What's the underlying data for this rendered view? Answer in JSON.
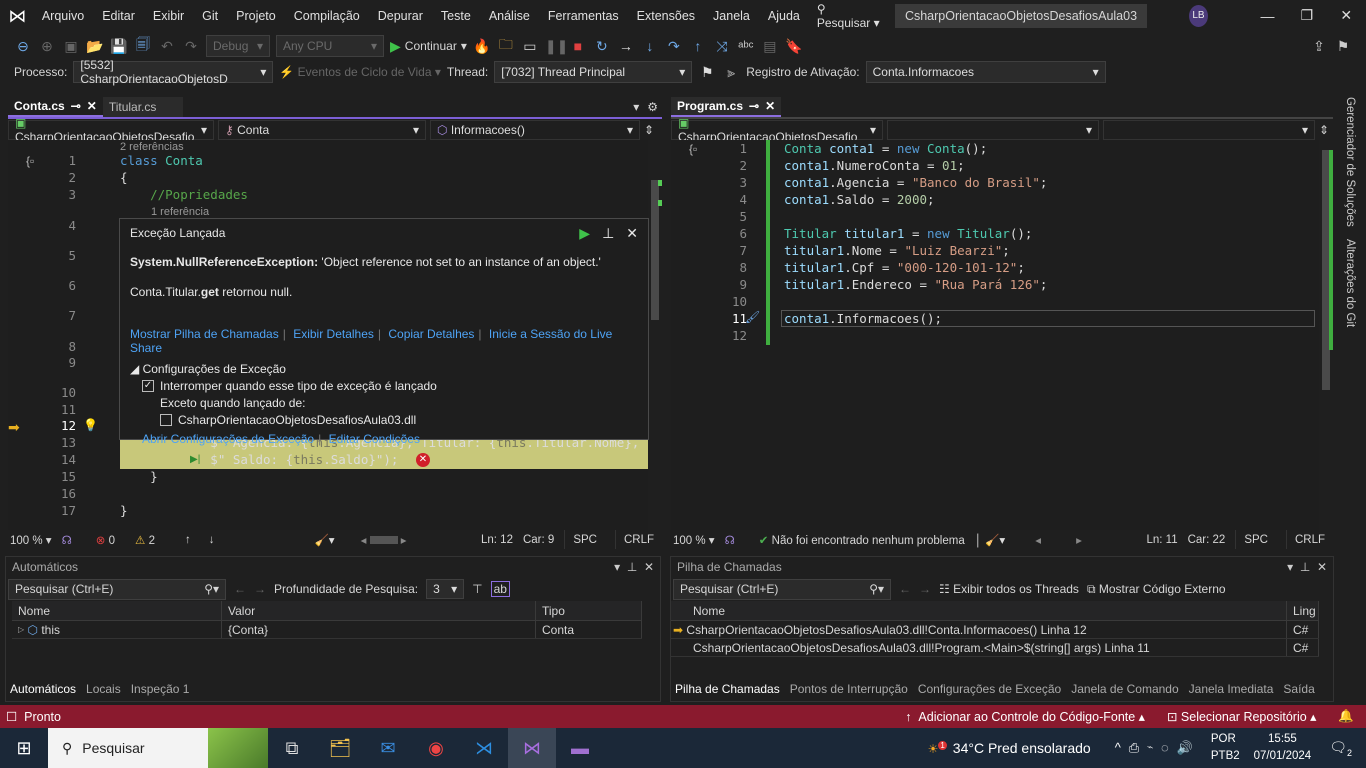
{
  "menubar": {
    "items": [
      "Arquivo",
      "Editar",
      "Exibir",
      "Git",
      "Projeto",
      "Compilação",
      "Depurar",
      "Teste",
      "Análise",
      "Ferramentas",
      "Extensões",
      "Janela",
      "Ajuda"
    ],
    "search": "Pesquisar",
    "title": "CsharpOrientacaoObjetosDesafiosAula03",
    "avatar": "LB"
  },
  "toolbar": {
    "config": "Debug",
    "platform": "Any CPU",
    "continue": "Continuar"
  },
  "debugbar": {
    "process_label": "Processo:",
    "process": "[5532] CsharpOrientacaoObjetosD",
    "lifecycle": "Eventos de Ciclo de Vida",
    "thread_label": "Thread:",
    "thread": "[7032] Thread Principal",
    "stack_label": "Registro de Ativação:",
    "stack": "Conta.Informacoes"
  },
  "left_editor": {
    "tabs": [
      {
        "label": "Conta.cs",
        "active": true
      },
      {
        "label": "Titular.cs",
        "active": false
      }
    ],
    "nav": [
      "CsharpOrientacaoObjetosDesafio",
      "Conta",
      "Informacoes()"
    ],
    "codelens": [
      "2 referências",
      "1 referência"
    ],
    "line_numbers": [
      "1",
      "2",
      "3",
      "4",
      "5",
      "6",
      "7",
      "8",
      "9",
      "10",
      "11",
      "12",
      "13",
      "14",
      "15",
      "16",
      "17"
    ],
    "current_line": "12",
    "code": [
      [
        [
          "kw",
          "class "
        ],
        [
          "ty",
          "Conta"
        ]
      ],
      [
        [
          "pl",
          "{"
        ]
      ],
      [
        [
          "cm",
          "    //Popriedades"
        ]
      ],
      [
        [
          "pl",
          "            $\" Agencia: {"
        ],
        [
          "dim",
          "this"
        ],
        [
          "pl",
          ".Agencia}, Titular: {"
        ],
        [
          "dim",
          "this"
        ],
        [
          "pl",
          ".Titular.Nome},"
        ]
      ],
      [
        [
          "pl",
          "            $\" Saldo: {"
        ],
        [
          "dim",
          "this"
        ],
        [
          "pl",
          ".Saldo}\");"
        ]
      ],
      [
        [
          "pl",
          "    }"
        ]
      ],
      [
        [
          "pl",
          "}"
        ]
      ]
    ],
    "status": {
      "zoom": "100 %",
      "errors": "0",
      "warnings": "2",
      "ln": "Ln: 12",
      "car": "Car: 9",
      "spc": "SPC",
      "crlf": "CRLF"
    }
  },
  "exception_popup": {
    "title": "Exceção Lançada",
    "exception_type": "System.NullReferenceException:",
    "message": "'Object reference not set to an instance of an object.'",
    "detail_pre": "Conta.Titular.",
    "detail_bold": "get",
    "detail_post": " retornou null.",
    "links": [
      "Mostrar Pilha de Chamadas",
      "Exibir Detalhes",
      "Copiar Detalhes",
      "Inicie a Sessão do Live Share"
    ],
    "settings_title": "Configurações de Exceção",
    "break_option": "Interromper quando esse tipo de exceção é lançado",
    "break_checked": true,
    "except_label": "Exceto quando lançado de:",
    "module": "CsharpOrientacaoObjetosDesafiosAula03.dll",
    "module_checked": false,
    "bottom_links": [
      "Abrir Configurações de Exceção",
      "Editar Condições"
    ]
  },
  "right_editor": {
    "tabs": [
      {
        "label": "Program.cs",
        "active": true
      }
    ],
    "nav": [
      "CsharpOrientacaoObjetosDesafio"
    ],
    "line_numbers": [
      "1",
      "2",
      "3",
      "4",
      "5",
      "6",
      "7",
      "8",
      "9",
      "10",
      "11",
      "12"
    ],
    "current_line": "11",
    "code": [
      [
        [
          "ty",
          "Conta "
        ],
        [
          "id",
          "conta1"
        ],
        [
          "pl",
          " = "
        ],
        [
          "kw",
          "new "
        ],
        [
          "ty",
          "Conta"
        ],
        [
          "pl",
          "();"
        ]
      ],
      [
        [
          "id",
          "conta1"
        ],
        [
          "pl",
          ".NumeroConta = "
        ],
        [
          "nu",
          "01"
        ],
        [
          "pl",
          ";"
        ]
      ],
      [
        [
          "id",
          "conta1"
        ],
        [
          "pl",
          ".Agencia = "
        ],
        [
          "st",
          "\"Banco do Brasil\""
        ],
        [
          "pl",
          ";"
        ]
      ],
      [
        [
          "id",
          "conta1"
        ],
        [
          "pl",
          ".Saldo = "
        ],
        [
          "nu",
          "2000"
        ],
        [
          "pl",
          ";"
        ]
      ],
      [],
      [
        [
          "ty",
          "Titular "
        ],
        [
          "id",
          "titular1"
        ],
        [
          "pl",
          " = "
        ],
        [
          "kw",
          "new "
        ],
        [
          "ty",
          "Titular"
        ],
        [
          "pl",
          "();"
        ]
      ],
      [
        [
          "id",
          "titular1"
        ],
        [
          "pl",
          ".Nome = "
        ],
        [
          "st",
          "\"Luiz Bearzi\""
        ],
        [
          "pl",
          ";"
        ]
      ],
      [
        [
          "id",
          "titular1"
        ],
        [
          "pl",
          ".Cpf = "
        ],
        [
          "st",
          "\"000-120-101-12\""
        ],
        [
          "pl",
          ";"
        ]
      ],
      [
        [
          "id",
          "titular1"
        ],
        [
          "pl",
          ".Endereco = "
        ],
        [
          "st",
          "\"Rua Pará 126\""
        ],
        [
          "pl",
          ";"
        ]
      ],
      [],
      [
        [
          "id",
          "conta1"
        ],
        [
          "pl",
          ".Informacoes();"
        ]
      ],
      []
    ],
    "status": {
      "zoom": "100 %",
      "health": "Não foi encontrado nenhum problema",
      "ln": "Ln: 11",
      "car": "Car: 22",
      "spc": "SPC",
      "crlf": "CRLF"
    }
  },
  "side_tabs": [
    "Gerenciador de Soluções",
    "Alterações do Git"
  ],
  "autos": {
    "title": "Automáticos",
    "search": "Pesquisar (Ctrl+E)",
    "depth_label": "Profundidade de Pesquisa:",
    "depth": "3",
    "columns": [
      "Nome",
      "Valor",
      "Tipo"
    ],
    "rows": [
      {
        "name": "this",
        "value": "{Conta}",
        "type": "Conta"
      }
    ],
    "tabs": [
      "Automáticos",
      "Locais",
      "Inspeção 1"
    ]
  },
  "callstack": {
    "title": "Pilha de Chamadas",
    "search": "Pesquisar (Ctrl+E)",
    "show_threads": "Exibir todos os Threads",
    "external": "Mostrar Código Externo",
    "columns": [
      "Nome",
      "Ling"
    ],
    "rows": [
      {
        "name": "CsharpOrientacaoObjetosDesafiosAula03.dll!Conta.Informacoes() Linha 12",
        "lang": "C#"
      },
      {
        "name": "CsharpOrientacaoObjetosDesafiosAula03.dll!Program.<Main>$(string[] args) Linha 11",
        "lang": "C#"
      }
    ],
    "tabs": [
      "Pilha de Chamadas",
      "Pontos de Interrupção",
      "Configurações de Exceção",
      "Janela de Comando",
      "Janela Imediata",
      "Saída"
    ]
  },
  "statusbar": {
    "ready": "Pronto",
    "source_control": "Adicionar ao Controle do Código-Fonte",
    "repo": "Selecionar Repositório",
    "color": "#8a1a2e"
  },
  "taskbar": {
    "search": "Pesquisar",
    "weather": "34°C  Pred ensolarado",
    "lang1": "POR",
    "lang2": "PTB2",
    "time": "15:55",
    "date": "07/01/2024",
    "notifications": "2",
    "weather_badge": "1"
  }
}
